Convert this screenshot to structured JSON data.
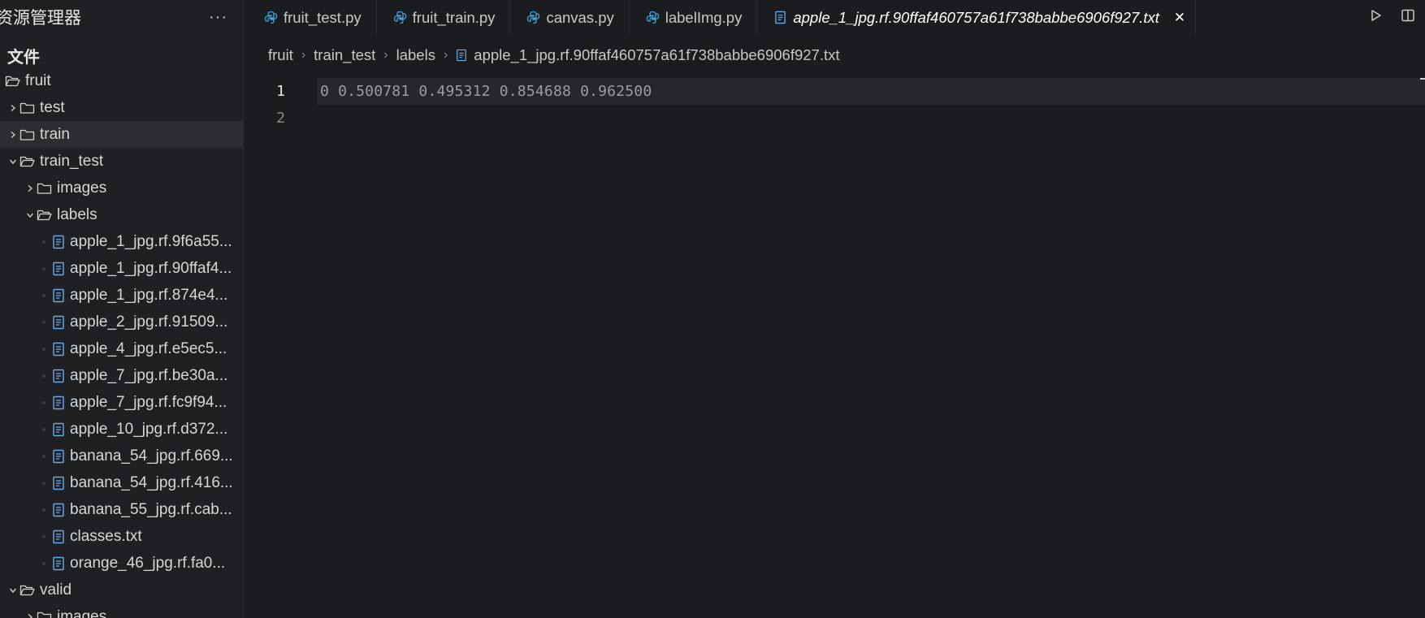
{
  "sidebar": {
    "title": "资源管理器",
    "more_label": "···",
    "section_label": "文件",
    "tree": [
      {
        "label": "fruit",
        "kind": "folder-open",
        "depth": 0,
        "chevron": "none"
      },
      {
        "label": "test",
        "kind": "folder",
        "depth": 1,
        "chevron": "right"
      },
      {
        "label": "train",
        "kind": "folder",
        "depth": 1,
        "chevron": "right",
        "selected": true
      },
      {
        "label": "train_test",
        "kind": "folder-open",
        "depth": 1,
        "chevron": "down"
      },
      {
        "label": "images",
        "kind": "folder",
        "depth": 2,
        "chevron": "right"
      },
      {
        "label": "labels",
        "kind": "folder-open",
        "depth": 2,
        "chevron": "down"
      },
      {
        "label": "apple_1_jpg.rf.9f6a55...",
        "kind": "file",
        "depth": 3
      },
      {
        "label": "apple_1_jpg.rf.90ffaf4...",
        "kind": "file",
        "depth": 3
      },
      {
        "label": "apple_1_jpg.rf.874e4...",
        "kind": "file",
        "depth": 3
      },
      {
        "label": "apple_2_jpg.rf.91509...",
        "kind": "file",
        "depth": 3
      },
      {
        "label": "apple_4_jpg.rf.e5ec5...",
        "kind": "file",
        "depth": 3
      },
      {
        "label": "apple_7_jpg.rf.be30a...",
        "kind": "file",
        "depth": 3
      },
      {
        "label": "apple_7_jpg.rf.fc9f94...",
        "kind": "file",
        "depth": 3
      },
      {
        "label": "apple_10_jpg.rf.d372...",
        "kind": "file",
        "depth": 3
      },
      {
        "label": "banana_54_jpg.rf.669...",
        "kind": "file",
        "depth": 3
      },
      {
        "label": "banana_54_jpg.rf.416...",
        "kind": "file",
        "depth": 3
      },
      {
        "label": "banana_55_jpg.rf.cab...",
        "kind": "file",
        "depth": 3
      },
      {
        "label": "classes.txt",
        "kind": "file",
        "depth": 3
      },
      {
        "label": "orange_46_jpg.rf.fa0...",
        "kind": "file",
        "depth": 3
      },
      {
        "label": "valid",
        "kind": "folder-open",
        "depth": 1,
        "chevron": "down"
      },
      {
        "label": "images",
        "kind": "folder",
        "depth": 2,
        "chevron": "right"
      }
    ]
  },
  "tabs": [
    {
      "label": "fruit_test.py",
      "icon": "python-icon"
    },
    {
      "label": "fruit_train.py",
      "icon": "python-icon"
    },
    {
      "label": "canvas.py",
      "icon": "python-icon"
    },
    {
      "label": "labelImg.py",
      "icon": "python-icon"
    },
    {
      "label": "apple_1_jpg.rf.90ffaf460757a61f738babbe6906f927.txt",
      "icon": "text-file-icon",
      "active": true,
      "close_label": "✕"
    }
  ],
  "breadcrumb": [
    "fruit",
    "train_test",
    "labels",
    "apple_1_jpg.rf.90ffaf460757a61f738babbe6906f927.txt"
  ],
  "editor": {
    "lines": [
      {
        "number": "1",
        "text": "0 0.500781 0.495312 0.854688 0.962500",
        "current": true
      },
      {
        "number": "2",
        "text": "",
        "current": false
      }
    ]
  },
  "colors": {
    "accent_icon": "#3fa7d6",
    "file_icon": "#6aa9e8",
    "background": "#1b1c1f",
    "sidebar_bg": "#1f2023"
  }
}
